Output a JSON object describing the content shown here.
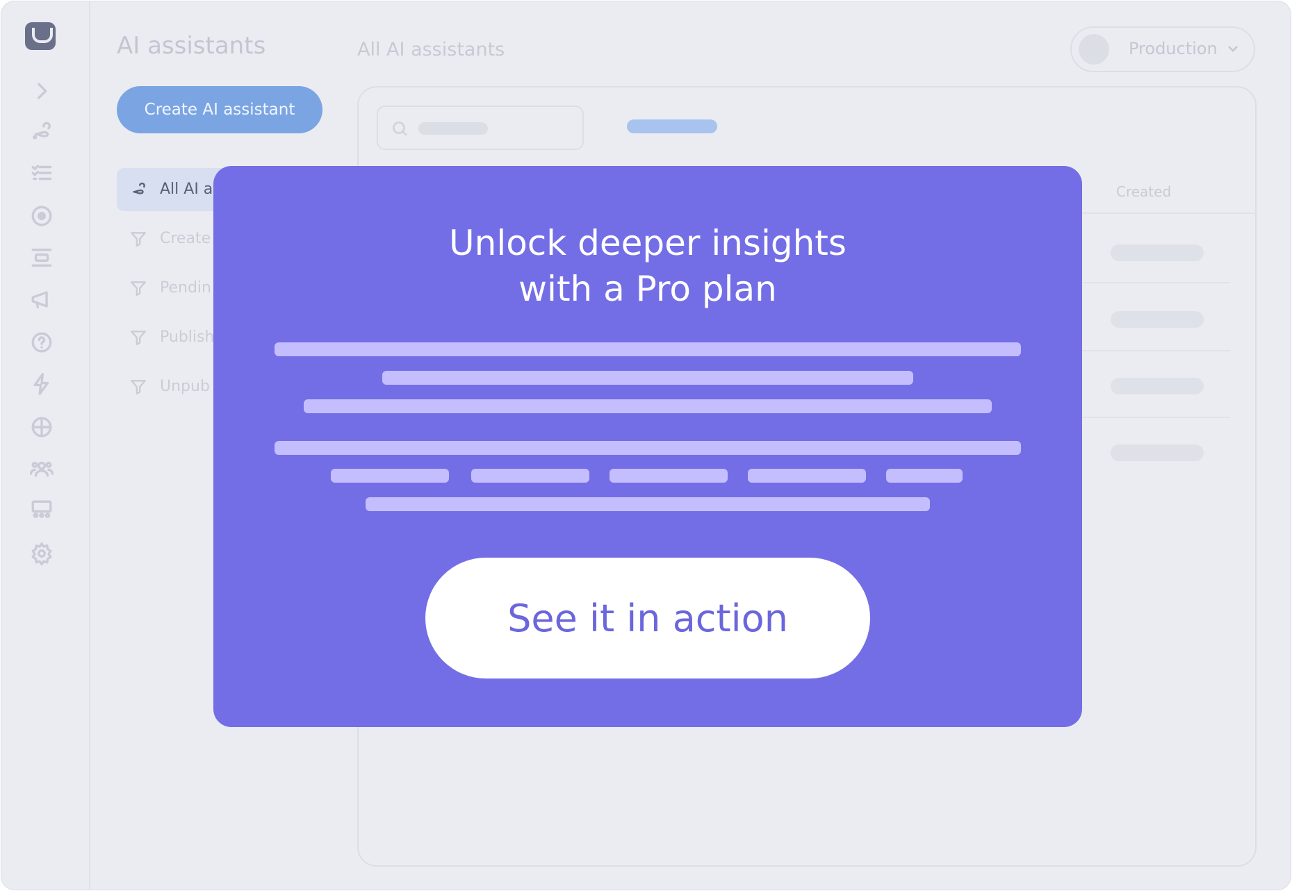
{
  "header": {
    "title": "AI assistants",
    "subtitle": "All AI assistants",
    "environment": "Production"
  },
  "actions": {
    "create_label": "Create AI assistant"
  },
  "side_nav": {
    "items": [
      {
        "label": "All AI a",
        "icon": "assistant-icon",
        "active": true
      },
      {
        "label": "Create",
        "icon": "filter-icon"
      },
      {
        "label": "Pendin",
        "icon": "filter-icon"
      },
      {
        "label": "Publish",
        "icon": "filter-icon"
      },
      {
        "label": "Unpub",
        "icon": "filter-icon"
      }
    ]
  },
  "table": {
    "columns": [
      "Created"
    ]
  },
  "modal": {
    "title_line1": "Unlock deeper insights",
    "title_line2": "with a Pro plan",
    "cta_label": "See it in action"
  },
  "colors": {
    "accent": "#736ee6",
    "button_blue": "#7aa5e2",
    "placeholder_bar": "#c4beff"
  },
  "rail_icons": [
    "logo-icon",
    "expand-chevron-icon",
    "assistant-icon",
    "checklist-icon",
    "target-icon",
    "layout-icon",
    "megaphone-icon",
    "help-icon",
    "lightning-icon",
    "pie-chart-icon",
    "users-icon",
    "team-icon",
    "gear-icon"
  ]
}
